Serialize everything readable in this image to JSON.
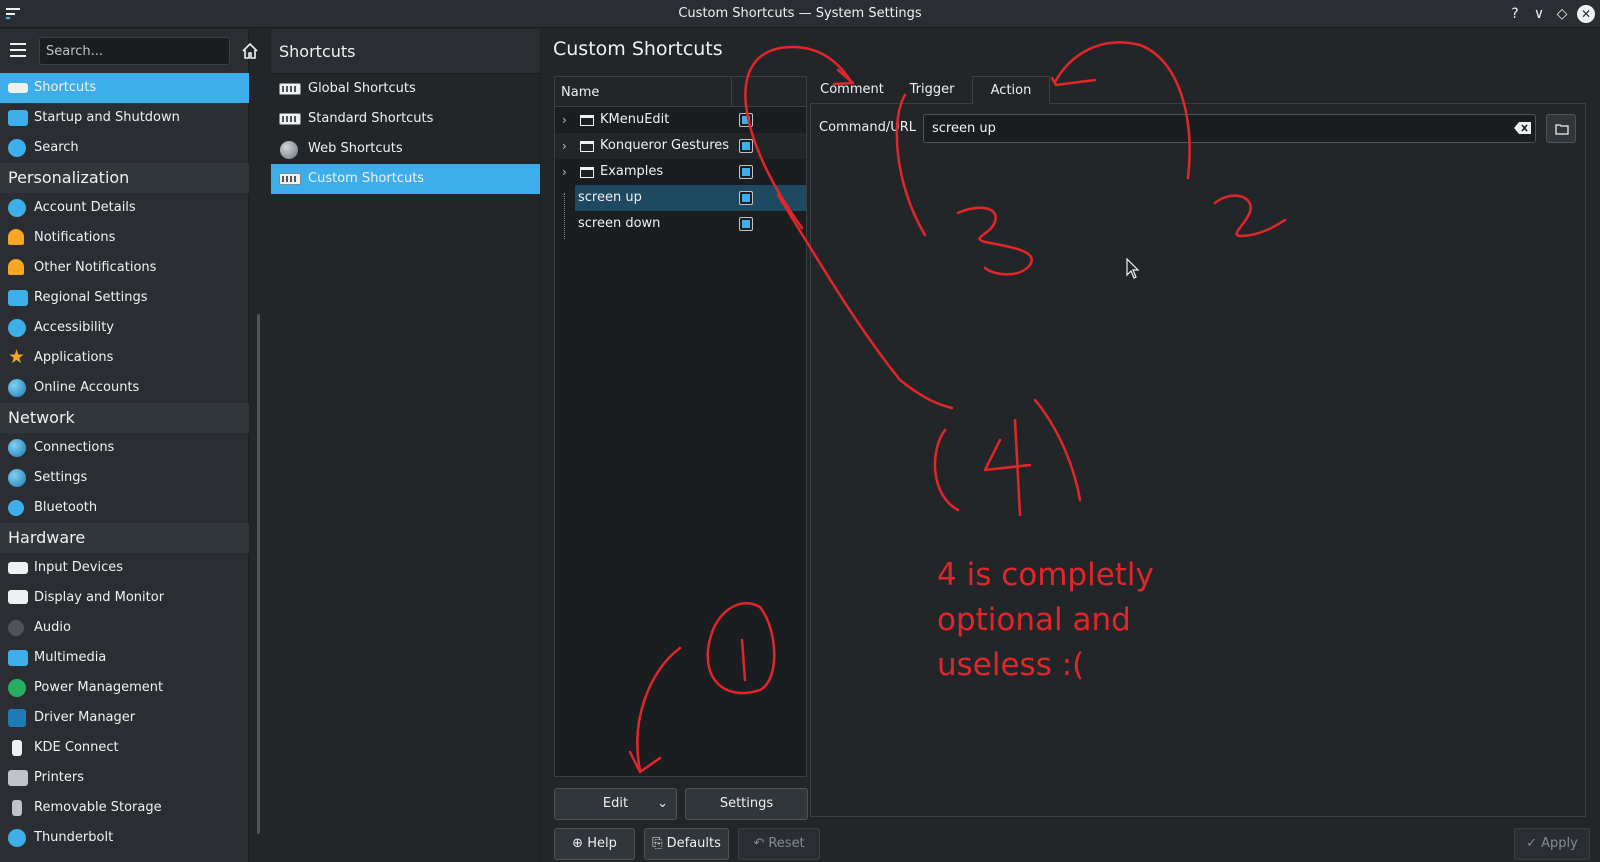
{
  "window": {
    "title": "Custom Shortcuts — System Settings",
    "help_glyph": "?",
    "minimize_glyph": "∨",
    "maximize_glyph": "◇",
    "close_glyph": "✕"
  },
  "sidebar": {
    "search_placeholder": "Search...",
    "items_top": [
      {
        "label": "Shortcuts",
        "icon": "keyboard-icon",
        "selected": true
      },
      {
        "label": "Startup and Shutdown",
        "icon": "startup-icon"
      },
      {
        "label": "Search",
        "icon": "search-icon"
      }
    ],
    "personalization": {
      "header": "Personalization",
      "items": [
        {
          "label": "Account Details",
          "icon": "user-icon"
        },
        {
          "label": "Notifications",
          "icon": "bell-icon"
        },
        {
          "label": "Other Notifications",
          "icon": "bell-icon"
        },
        {
          "label": "Regional Settings",
          "icon": "regional-icon"
        },
        {
          "label": "Accessibility",
          "icon": "accessibility-icon"
        },
        {
          "label": "Applications",
          "icon": "star-icon"
        },
        {
          "label": "Online Accounts",
          "icon": "globe-icon"
        }
      ]
    },
    "network": {
      "header": "Network",
      "items": [
        {
          "label": "Connections",
          "icon": "globe-icon"
        },
        {
          "label": "Settings",
          "icon": "globe-icon"
        },
        {
          "label": "Bluetooth",
          "icon": "bluetooth-icon"
        }
      ]
    },
    "hardware": {
      "header": "Hardware",
      "items": [
        {
          "label": "Input Devices",
          "icon": "keyboard-icon"
        },
        {
          "label": "Display and Monitor",
          "icon": "monitor-icon"
        },
        {
          "label": "Audio",
          "icon": "speaker-icon"
        },
        {
          "label": "Multimedia",
          "icon": "multimedia-icon"
        },
        {
          "label": "Power Management",
          "icon": "power-icon"
        },
        {
          "label": "Driver Manager",
          "icon": "driver-icon"
        },
        {
          "label": "KDE Connect",
          "icon": "phone-icon"
        },
        {
          "label": "Printers",
          "icon": "printer-icon"
        },
        {
          "label": "Removable Storage",
          "icon": "usb-icon"
        },
        {
          "label": "Thunderbolt",
          "icon": "thunderbolt-icon"
        }
      ]
    }
  },
  "shortcuts_column": {
    "header": "Shortcuts",
    "items": [
      {
        "label": "Global Shortcuts"
      },
      {
        "label": "Standard Shortcuts"
      },
      {
        "label": "Web Shortcuts"
      },
      {
        "label": "Custom Shortcuts",
        "selected": true
      }
    ]
  },
  "main": {
    "title": "Custom Shortcuts",
    "tree": {
      "column_name": "Name",
      "rows": [
        {
          "label": "KMenuEdit",
          "type": "folder"
        },
        {
          "label": "Konqueror Gestures",
          "type": "folder"
        },
        {
          "label": "Examples",
          "type": "folder"
        },
        {
          "label": "screen up",
          "type": "leaf",
          "selected": true
        },
        {
          "label": "screen down",
          "type": "leaf"
        }
      ]
    },
    "buttons": {
      "edit": "Edit",
      "settings": "Settings",
      "help": "Help",
      "defaults": "Defaults",
      "reset": "Reset",
      "apply": "Apply"
    },
    "tabs": [
      "Comment",
      "Trigger",
      "Action"
    ],
    "active_tab": "Action",
    "command_label": "Command/URL",
    "command_value": "screen up"
  },
  "annotation": {
    "color": "#e0262a",
    "numbers": [
      "1",
      "2",
      "3",
      "(4)"
    ],
    "note": "4 is completly optional and useless :("
  }
}
